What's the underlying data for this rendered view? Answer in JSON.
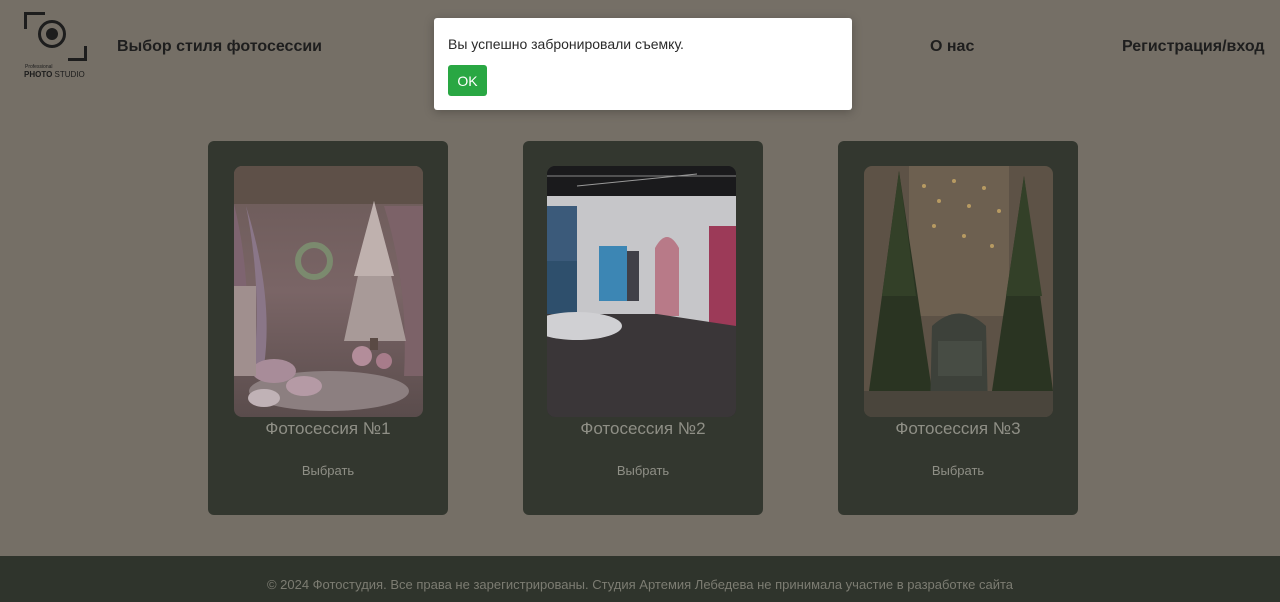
{
  "logo": {
    "small": "Professional",
    "big_bold": "PHOTO",
    "big_rest": " STUDIO"
  },
  "nav": {
    "styles": "Выбор стиля фотосессии",
    "about": "О нас",
    "auth": "Регистрация/вход"
  },
  "modal": {
    "message": "Вы успешно забронировали съемку.",
    "ok_label": "OK",
    "ok_color": "#29a743"
  },
  "cards": [
    {
      "title": "Фотосессия №1",
      "button": "Выбрать",
      "image": "christmas-pink-studio"
    },
    {
      "title": "Фотосессия №2",
      "button": "Выбрать",
      "image": "modern-arch-studio"
    },
    {
      "title": "Фотосессия №3",
      "button": "Выбрать",
      "image": "christmas-trees-armchair-studio"
    }
  ],
  "footer": {
    "text": "© 2024 Фотостудия. Все права не зарегистрированы. Студия Артемия Лебедева не принимала участие в разработке сайта"
  },
  "colors": {
    "page_bg": "#756f66",
    "card_bg": "#33372f",
    "footer_bg": "#2f342c"
  }
}
